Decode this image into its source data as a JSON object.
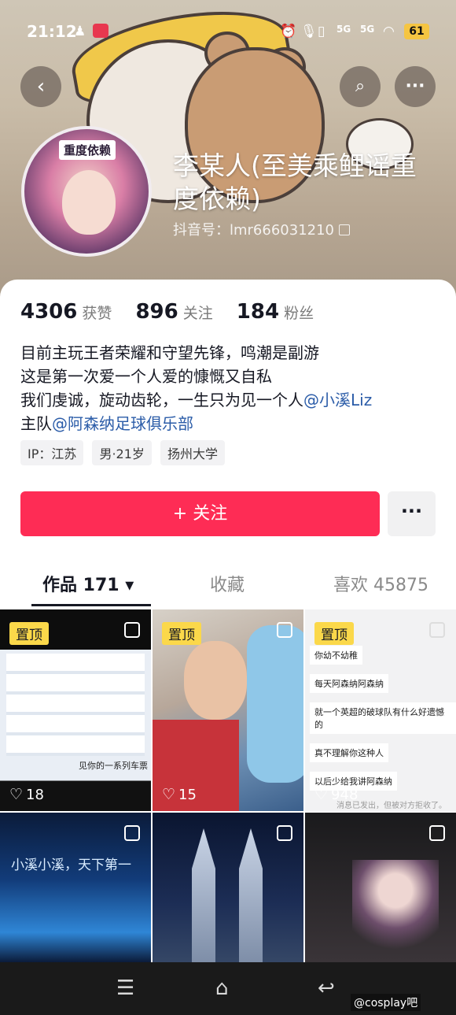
{
  "status_bar": {
    "time": "21:12",
    "battery": "61",
    "signal_1": "5G",
    "signal_2": "5G"
  },
  "header": {
    "back_icon": "back-arrow-icon",
    "search_icon": "search-icon",
    "more_icon": "more-dots-icon"
  },
  "profile": {
    "avatar_tag": "重度依赖",
    "nickname": "李某人(至美乘鲤谣重度依赖)",
    "douyin_id": "抖音号：lmr666031210"
  },
  "stats": [
    {
      "num": "4306",
      "label": "获赞"
    },
    {
      "num": "896",
      "label": "关注"
    },
    {
      "num": "184",
      "label": "粉丝"
    }
  ],
  "bio": {
    "line1": "目前主玩王者荣耀和守望先锋，鸣潮是副游",
    "line2": "这是第一次爱一个人爱的慷慨又自私",
    "line3_text": "我们虔诚，旋动齿轮，一生只为见一个人",
    "line3_mention": "@小溪Liz",
    "line4_text": "主队",
    "line4_mention": "@阿森纳足球俱乐部"
  },
  "tags": [
    "IP：江苏",
    "男·21岁",
    "扬州大学"
  ],
  "actions": {
    "follow_label": "+ 关注",
    "more_label": "···"
  },
  "tabs": [
    {
      "label": "作品 171 ▾"
    },
    {
      "label": "收藏"
    },
    {
      "label": "喜欢 45875"
    }
  ],
  "grid": [
    {
      "pinned": "置顶",
      "likes": "18",
      "caption": "见你的一系列车票"
    },
    {
      "pinned": "置顶",
      "likes": "15"
    },
    {
      "pinned": "置顶",
      "likes": "948",
      "chat": [
        "你幼不幼稚",
        "每天阿森纳阿森纳",
        "就一个英超的破球队有什么好遗憾的",
        "真不理解你这种人",
        "以后少给我讲阿森纳"
      ],
      "footer_text": "消息已发出，但被对方拒收了。"
    },
    {
      "pinned": "",
      "likes": "",
      "overlay_text": "小溪小溪，天下第一"
    },
    {
      "pinned": "",
      "likes": ""
    },
    {
      "pinned": "",
      "likes": ""
    }
  ],
  "navbar": {
    "watermark": "@cosplay吧"
  },
  "colors": {
    "accent": "#fe2c55",
    "mention": "#2b5ca8",
    "pin": "#fbd84a"
  }
}
